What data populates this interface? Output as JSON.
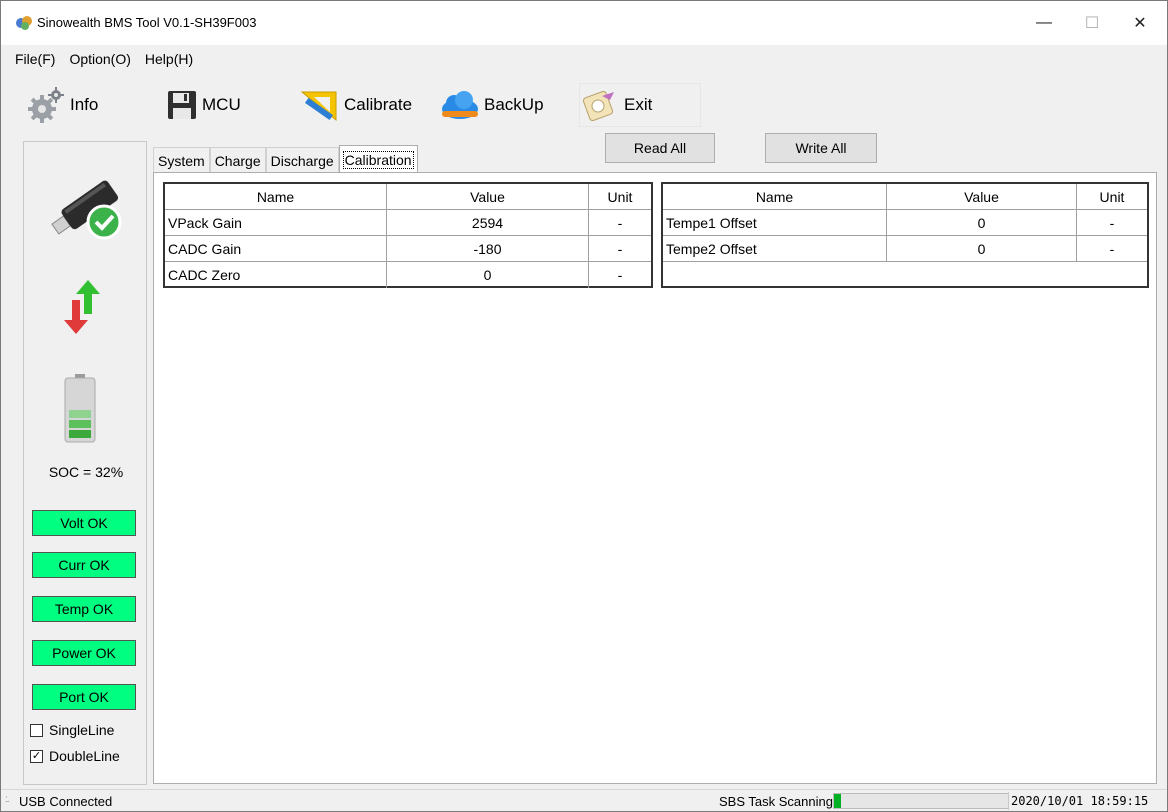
{
  "window": {
    "title": "Sinowealth BMS Tool V0.1-SH39F003",
    "controls": {
      "minimize": "—",
      "maximize": "☐",
      "close": "✕"
    }
  },
  "menu": [
    "File(F)",
    "Option(O)",
    "Help(H)"
  ],
  "toolbar": {
    "info": {
      "label": "Info",
      "icon": "gear-icon"
    },
    "mcu": {
      "label": "MCU",
      "icon": "floppy-disk-icon"
    },
    "calibrate": {
      "label": "Calibrate",
      "icon": "set-square-icon"
    },
    "backup": {
      "label": "BackUp",
      "icon": "cloud-icon"
    },
    "exit": {
      "label": "Exit",
      "icon": "disk-exit-icon"
    }
  },
  "left_panel": {
    "soc": "SOC = 32%",
    "status_buttons": [
      "Volt OK",
      "Curr OK",
      "Temp OK",
      "Power OK",
      "Port OK"
    ],
    "status_color": "#00ff80",
    "single_line": {
      "label": "SingleLine",
      "checked": false
    },
    "double_line": {
      "label": "DoubleLine",
      "checked": true,
      "mark": "✓"
    }
  },
  "tabs": [
    "System",
    "Charge",
    "Discharge",
    "Calibration"
  ],
  "active_tab": "Calibration",
  "actions": {
    "read_all": "Read All",
    "write_all": "Write All"
  },
  "table_left": {
    "headers": [
      "Name",
      "Value",
      "Unit"
    ],
    "rows": [
      [
        "VPack Gain",
        "2594",
        "-"
      ],
      [
        "CADC Gain",
        "-180",
        "-"
      ],
      [
        "CADC Zero",
        "0",
        "-"
      ]
    ]
  },
  "table_right": {
    "headers": [
      "Name",
      "Value",
      "Unit"
    ],
    "rows": [
      [
        "Tempe1 Offset",
        "0",
        "-"
      ],
      [
        "Tempe2 Offset",
        "0",
        "-"
      ]
    ]
  },
  "status_bar": {
    "grip": ":.",
    "connection": "USB Connected",
    "task": "SBS Task Scanning",
    "progress_fraction": 0.04,
    "progress_color": "#06b025",
    "datetime": "2020/10/01 18:59:15"
  }
}
